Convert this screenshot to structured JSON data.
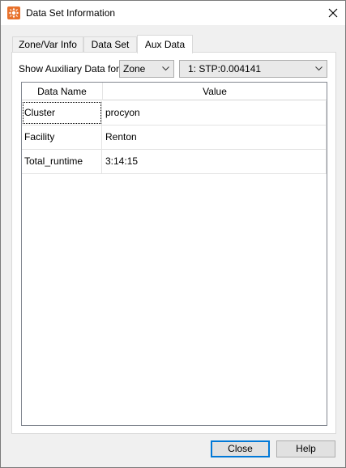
{
  "window": {
    "title": "Data Set Information",
    "icon": "app-logo-icon",
    "close_icon": "close-icon"
  },
  "tabs": [
    {
      "label": "Zone/Var Info",
      "active": false
    },
    {
      "label": "Data Set",
      "active": false
    },
    {
      "label": "Aux Data",
      "active": true
    }
  ],
  "aux": {
    "show_label": "Show Auxiliary Data for:",
    "type_select": {
      "value": "Zone"
    },
    "item_select": {
      "value": "1: STP:0.004141"
    }
  },
  "grid": {
    "columns": [
      "Data Name",
      "Value"
    ],
    "rows": [
      {
        "name": "Cluster",
        "value": "procyon"
      },
      {
        "name": "Facility",
        "value": "Renton"
      },
      {
        "name": "Total_runtime",
        "value": "3:14:15"
      }
    ]
  },
  "buttons": {
    "close_label": "Close",
    "help_label": "Help"
  },
  "colors": {
    "accent": "#0078d7",
    "icon_orange": "#e8712b"
  }
}
